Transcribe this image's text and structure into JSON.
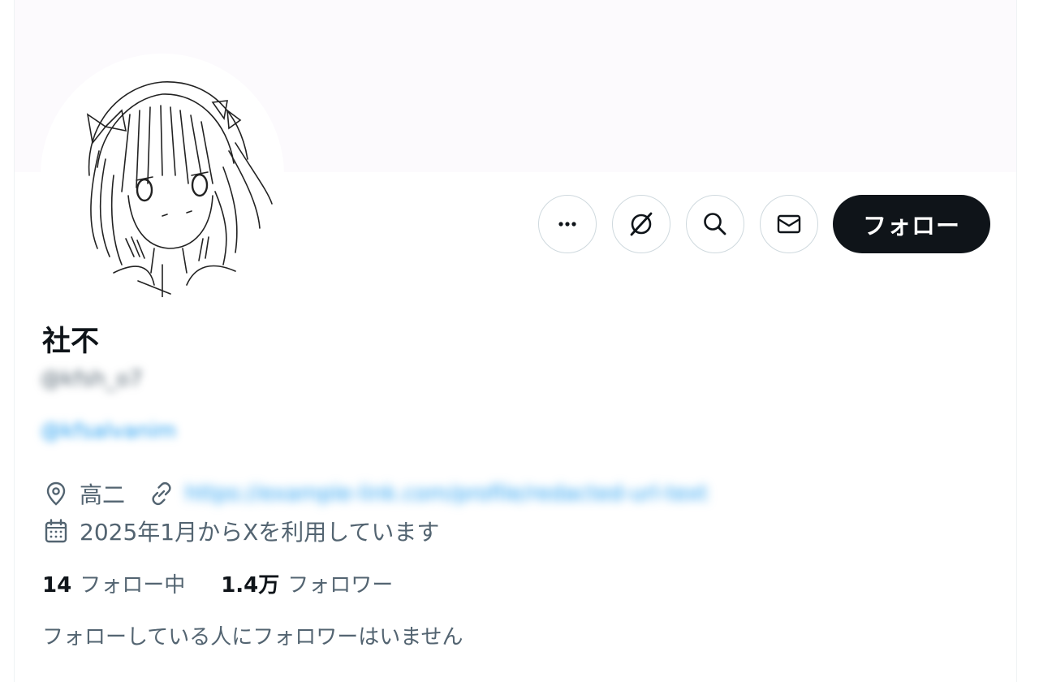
{
  "profile": {
    "display_name": "社不",
    "handle": "@kfsh_o7",
    "bio_link": "@kfsalvanim",
    "location": "高二",
    "website": "https://example-link.com/profile/redacted-url-text",
    "joined": "2025年1月からXを利用しています"
  },
  "actions": {
    "more_label": "その他",
    "grok_label": "Grok",
    "search_label": "検索",
    "message_label": "メッセージ",
    "follow_label": "フォロー"
  },
  "stats": {
    "following_count": "14",
    "following_label": "フォロー中",
    "followers_count": "1.4万",
    "followers_label": "フォロワー"
  },
  "followers_you_know": "フォローしている人にフォロワーはいません",
  "icons": {
    "more": "more-dots-icon",
    "grok": "grok-icon",
    "search": "search-icon",
    "message": "envelope-icon",
    "location": "location-pin-icon",
    "link": "link-icon",
    "calendar": "calendar-icon"
  },
  "colors": {
    "banner": "#fcfafd",
    "follow_button": "#0f1419",
    "secondary_text": "#536471",
    "link": "#1d9bf0"
  }
}
